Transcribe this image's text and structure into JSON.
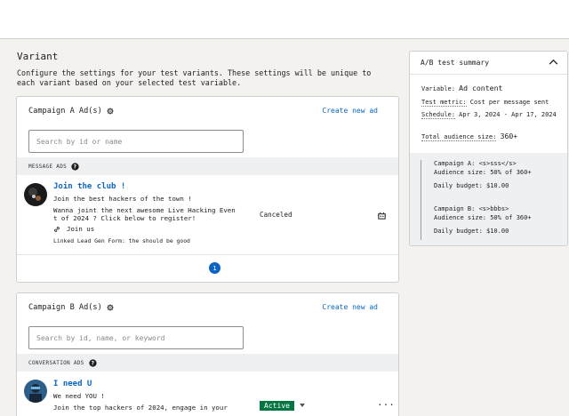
{
  "section": {
    "title": "Variant",
    "description": "Configure the settings for your test variants. These settings will be unique to each variant based on your selected test variable."
  },
  "campaign_a": {
    "title": "Campaign A Ad(s)",
    "create_label": "Create new ad",
    "search_placeholder": "Search by id or name",
    "section_label": "MESSAGE ADS",
    "ad": {
      "title": "Join the club !",
      "line1": "Join the best hackers of the town !",
      "line2": "Wanna joint the next awesome Live Hacking Even",
      "line3": "t of 2024 ? Click below to register!",
      "join_label": "Join us",
      "form_label": "Linked Lead Gen Form: the should be good",
      "status": "Canceled"
    },
    "page": "1"
  },
  "campaign_b": {
    "title": "Campaign B Ad(s)",
    "create_label": "Create new ad",
    "search_placeholder": "Search by id, name, or keyword",
    "section_label": "CONVERSATION ADS",
    "ad": {
      "title": "I need U",
      "line1": "We need YOU !",
      "line2": "Join the top hackers of 2024, engage in your",
      "status": "Active",
      "more": "···"
    }
  },
  "summary": {
    "title": "A/B test summary",
    "variable_label": "Variable:",
    "variable_value": "Ad content",
    "metric_label": "Test metric:",
    "metric_value": "Cost per message sent",
    "schedule_label": "Schedule:",
    "schedule_value": "Apr 3, 2024 - Apr 17, 2024",
    "audience_label": "Total audience size:",
    "audience_value": "360+",
    "variant_a": {
      "name": "Campaign A: <s>sss</s>",
      "audience": "Audience size: 50% of 360+",
      "budget": "Daily budget: $10.00"
    },
    "variant_b": {
      "name": "Campaign B: <s>bbbs>",
      "audience": "Audience size: 50% of 360+",
      "budget": "Daily budget: $10.00"
    }
  },
  "colors": {
    "accent": "#0a66c2",
    "active": "#057642",
    "section_bg": "#eef0f2"
  }
}
